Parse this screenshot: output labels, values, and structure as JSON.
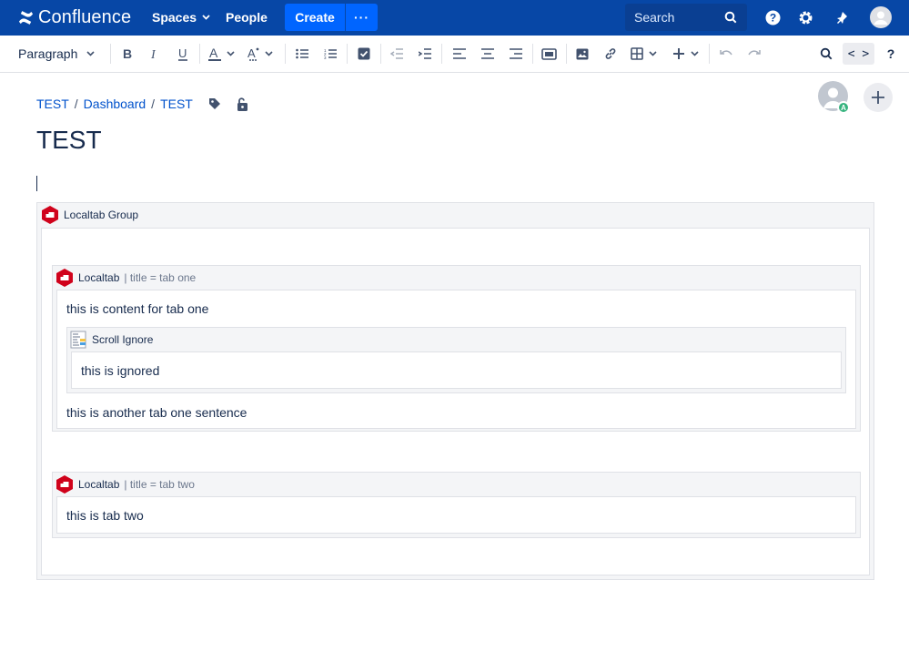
{
  "app": {
    "brand": "Confluence",
    "brand_color": "#0747a6",
    "accent_color": "#0065ff"
  },
  "topnav": {
    "spaces_label": "Spaces",
    "people_label": "People",
    "create_label": "Create",
    "more_label": "···",
    "search_placeholder": "Search",
    "icons": [
      "help-icon",
      "settings-icon",
      "notifications-icon",
      "profile-avatar"
    ]
  },
  "toolbar": {
    "paragraph_label": "Paragraph",
    "source_label": "< >",
    "buttons": [
      "bold",
      "italic",
      "underline",
      "text-color",
      "text-formats",
      "bullet-list",
      "numbered-list",
      "task-list",
      "outdent",
      "indent",
      "align-left",
      "align-center",
      "align-right",
      "page-layout",
      "image",
      "link",
      "table",
      "insert-more",
      "undo",
      "redo",
      "find-replace",
      "source-editor",
      "help"
    ]
  },
  "breadcrumb": {
    "items": [
      "TEST",
      "Dashboard",
      "TEST"
    ],
    "separator": "/"
  },
  "page": {
    "title": "TEST",
    "avatar_badge": "A"
  },
  "localtab_group": {
    "title": "Localtab Group",
    "tabs": [
      {
        "macro_name": "Localtab",
        "param": "| title = tab one",
        "content_1": "this is content for tab one",
        "scroll_ignore": {
          "title": "Scroll Ignore",
          "content": "this is ignored"
        },
        "content_2": "this is another tab one sentence"
      },
      {
        "macro_name": "Localtab",
        "param": "| title = tab two",
        "content_1": "this is tab two"
      }
    ]
  }
}
